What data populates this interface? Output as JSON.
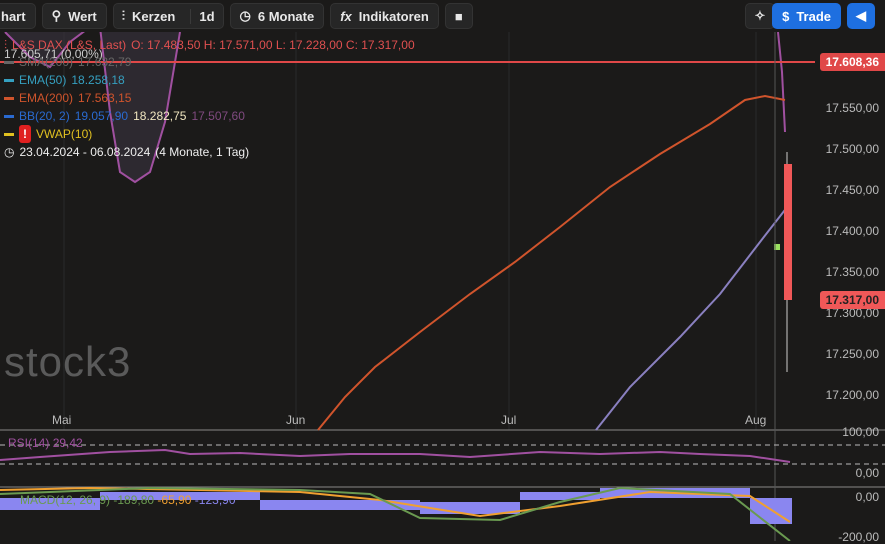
{
  "toolbar": {
    "chart": "hart",
    "value": "Wert",
    "type": "Kerzen",
    "interval": "1d",
    "range": "6 Monate",
    "indicators": "Indikatoren",
    "trade": "Trade"
  },
  "legend": {
    "instrument": "L&S DAX (L&S, Last)",
    "ohlc": "O: 17.483,50  H: 17.571,00  L: 17.228,00  C: 17.317,00",
    "change": "17.605,71 (0,00%)",
    "sma": "SMA(200)",
    "sma_val": "17.632,79",
    "ema50": "EMA(50)",
    "ema50_val": "18.258,18",
    "ema200": "EMA(200)",
    "ema200_val": "17.563,15",
    "bb": "BB(20, 2)",
    "bb_upper": "19.057,90",
    "bb_mid": "18.282,75",
    "bb_lower": "17.507,60",
    "vwap": "VWAP(10)",
    "period": "23.04.2024 - 06.08.2024",
    "period_len": "(4 Monate, 1 Tag)"
  },
  "price_axis": [
    "17.550,00",
    "17.500,00",
    "17.450,00",
    "17.400,00",
    "17.350,00",
    "17.300,00",
    "17.250,00",
    "17.200,00"
  ],
  "price_tags": {
    "line": "17.608,36",
    "last": "17.317,00"
  },
  "x_axis": [
    "Mai",
    "Jun",
    "Jul",
    "Aug"
  ],
  "logo": "stock3",
  "rsi": {
    "label": "RSI(14)",
    "value": "29,42",
    "axis": [
      "100,00",
      "0,00"
    ]
  },
  "macd": {
    "label": "MACD(12, 26, 9)",
    "macd": "-189,80",
    "signal": "-65,90",
    "hist": "-123,90",
    "axis": [
      "0,00",
      "-200,00"
    ]
  },
  "colors": {
    "bg": "#1b1a19",
    "red": "#e04848",
    "ema200": "#d0542c",
    "sma": "#8a80c0",
    "bb": "#a050a0",
    "macd_hist": "#8a86f0"
  }
}
